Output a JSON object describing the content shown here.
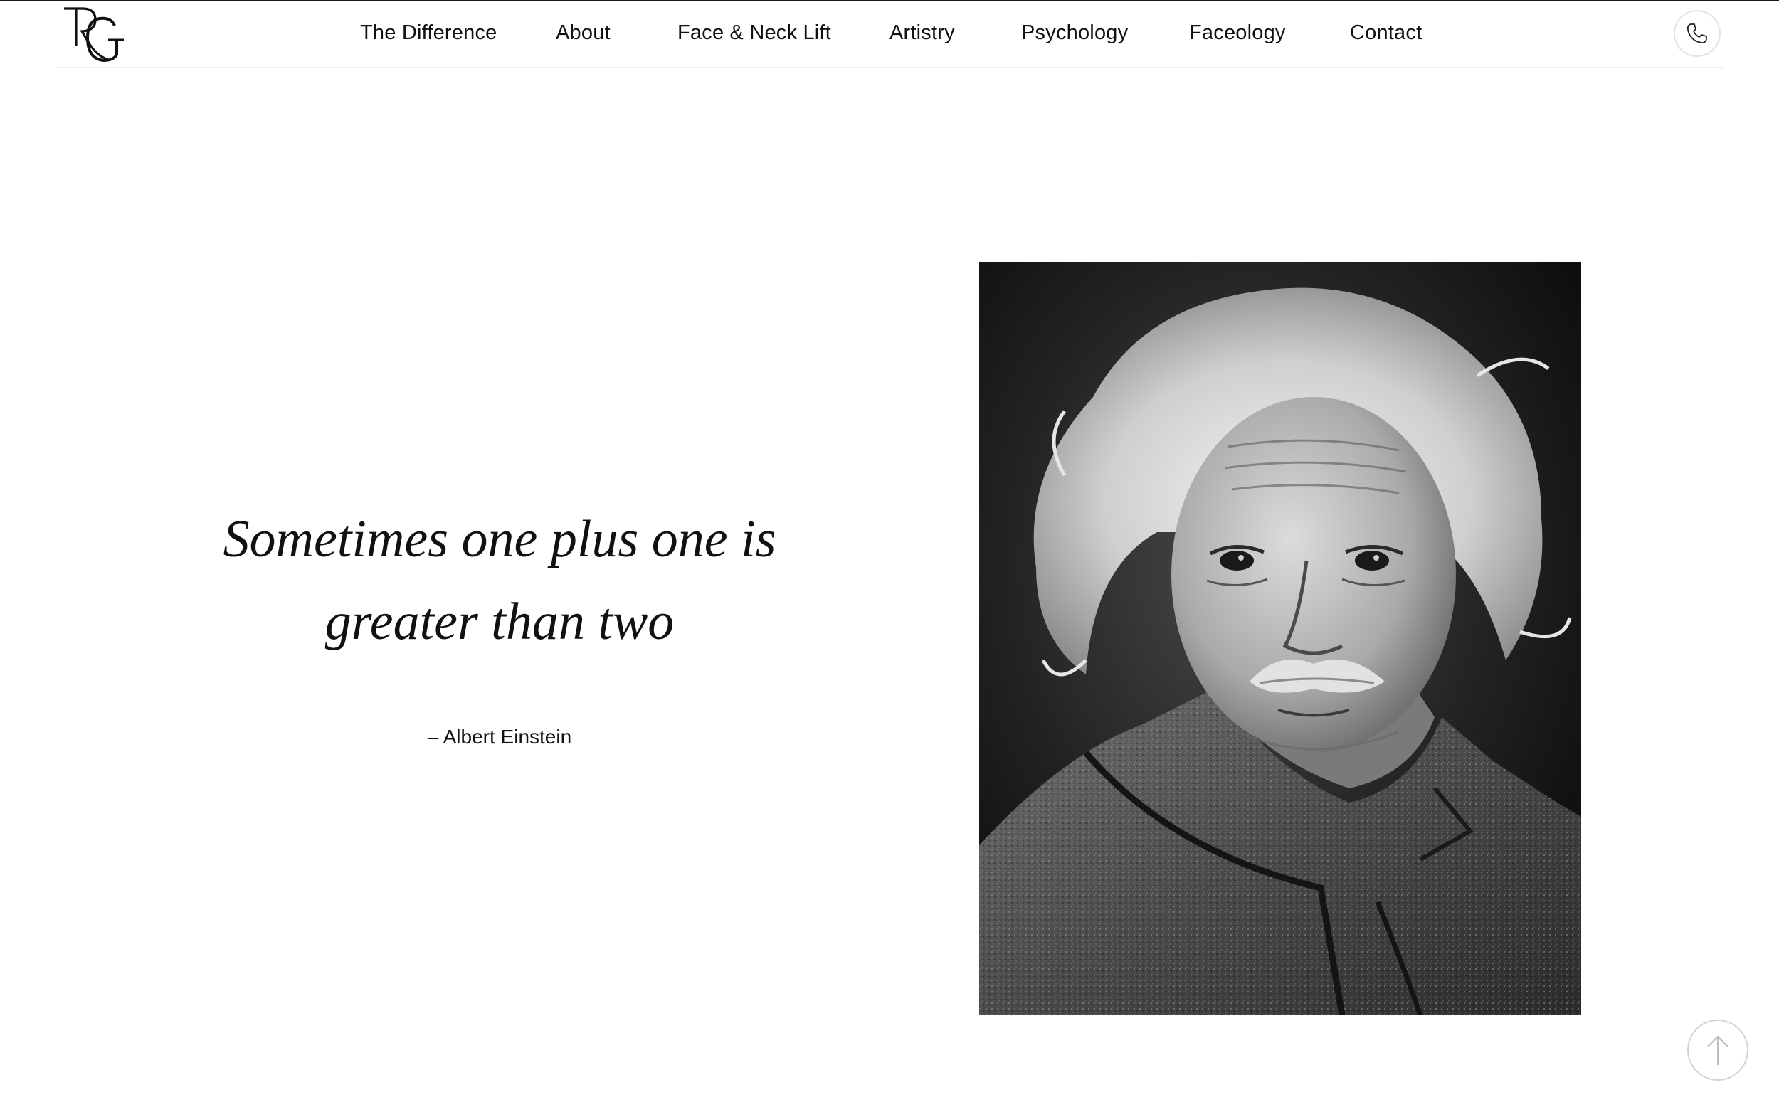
{
  "header": {
    "logo_text": "RG",
    "nav": [
      {
        "label": "The Difference"
      },
      {
        "label": "About"
      },
      {
        "label": "Face & Neck Lift"
      },
      {
        "label": "Artistry"
      },
      {
        "label": "Psychology"
      },
      {
        "label": "Faceology"
      },
      {
        "label": "Contact"
      }
    ],
    "phone_icon": "phone-icon"
  },
  "quote": {
    "text": "Sometimes one plus one is greater than two",
    "author": "– Albert Einstein"
  },
  "portrait": {
    "subject": "black-and-white portrait photograph"
  },
  "scroll_top": {
    "icon": "arrow-up-icon"
  },
  "colors": {
    "background": "#ffffff",
    "text": "#111111",
    "divider": "#efefef",
    "button_border": "#d4d4d4"
  }
}
